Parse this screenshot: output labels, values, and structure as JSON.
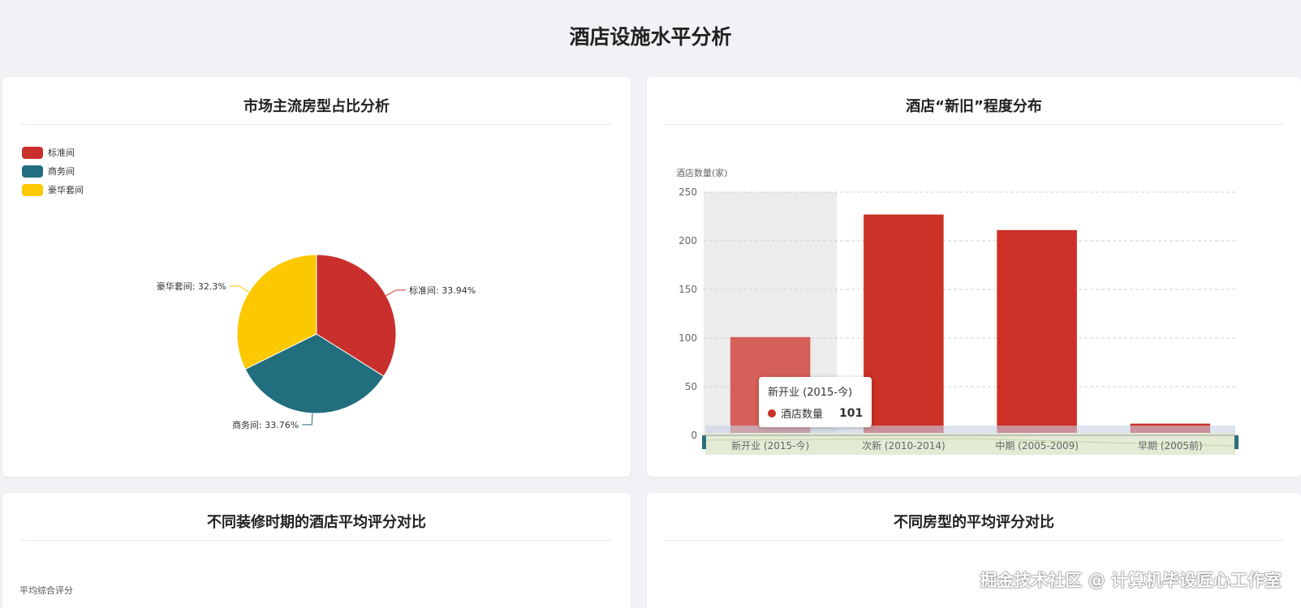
{
  "page": {
    "title": "酒店设施水平分析"
  },
  "cards": {
    "room_type": {
      "title": "市场主流房型占比分析"
    },
    "age": {
      "title": "酒店“新旧”程度分布"
    },
    "renovation": {
      "title": "不同装修时期的酒店平均评分对比",
      "ylabel": "平均综合评分"
    },
    "room_rating": {
      "title": "不同房型的平均评分对比"
    }
  },
  "chart_data": [
    {
      "type": "pie",
      "title": "市场主流房型占比分析",
      "legend_position": "top-left",
      "slices": [
        {
          "name": "标准间",
          "value": 33.94,
          "label": "标准间: 33.94%",
          "color": "#c9302c"
        },
        {
          "name": "商务间",
          "value": 33.76,
          "label": "商务间: 33.76%",
          "color": "#216e7e"
        },
        {
          "name": "豪华套间",
          "value": 32.3,
          "label": "豪华套间: 32.3%",
          "color": "#fcc800"
        }
      ]
    },
    {
      "type": "bar",
      "title": "酒店“新旧”程度分布",
      "ylabel": "酒店数量(家)",
      "ylim": [
        0,
        250
      ],
      "yticks": [
        "0",
        "50",
        "100",
        "150",
        "200",
        "250"
      ],
      "grid": true,
      "categories": [
        "新开业 (2015-今)",
        "次新 (2010-2014)",
        "中期 (2005-2009)",
        "早期 (2005前)"
      ],
      "series": [
        {
          "name": "酒店数量",
          "values": [
            101,
            227,
            211,
            12
          ],
          "color": "#cc3128"
        }
      ],
      "highlighted_category": "新开业 (2015-今)",
      "tooltip": {
        "title": "新开业 (2015-今)",
        "series": "酒店数量",
        "value": "101"
      }
    }
  ],
  "watermark": "掘金技术社区 @ 计算机毕设匠心工作室"
}
